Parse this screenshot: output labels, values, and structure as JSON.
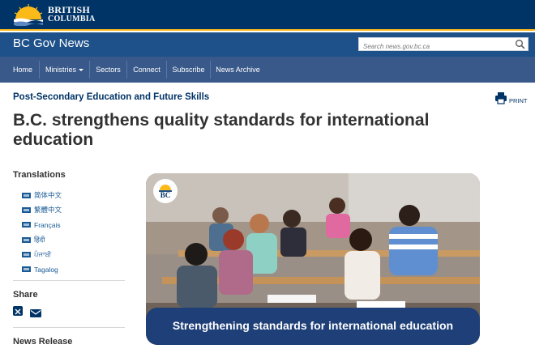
{
  "header": {
    "logo_line1": "BRITISH",
    "logo_line2": "COLUMBIA",
    "site_title": "BC Gov News",
    "search_placeholder": "Search news.gov.bc.ca"
  },
  "nav": {
    "items": [
      {
        "label": "Home"
      },
      {
        "label": "Ministries"
      },
      {
        "label": "Sectors"
      },
      {
        "label": "Connect"
      },
      {
        "label": "Subscribe"
      },
      {
        "label": "News Archive"
      }
    ]
  },
  "article": {
    "ministry": "Post-Secondary Education and Future Skills",
    "print_label": "PRINT",
    "headline": "B.C. strengthens quality standards for international education"
  },
  "sidebar": {
    "translations_heading": "Translations",
    "translations": [
      {
        "label": "简体中文"
      },
      {
        "label": "繁體中文"
      },
      {
        "label": "Français"
      },
      {
        "label": "हिंदी"
      },
      {
        "label": "ਪੰਜਾਬੀ"
      },
      {
        "label": "Tagalog"
      }
    ],
    "share_heading": "Share",
    "news_release_heading": "News Release"
  },
  "hero": {
    "badge_text": "BC",
    "caption": "Strengthening standards for international education"
  },
  "colors": {
    "top_bar": "#003366",
    "site_bar": "#1e5189",
    "nav_bar": "#38598a",
    "accent_gold": "#fcba19",
    "caption_band": "#1e3f78",
    "link": "#1a5a96"
  },
  "icons": {
    "search": "search-icon",
    "print": "printer-icon",
    "share_x": "x-icon",
    "share_email": "mail-icon",
    "ministries_dropdown": "caret-down-icon"
  }
}
